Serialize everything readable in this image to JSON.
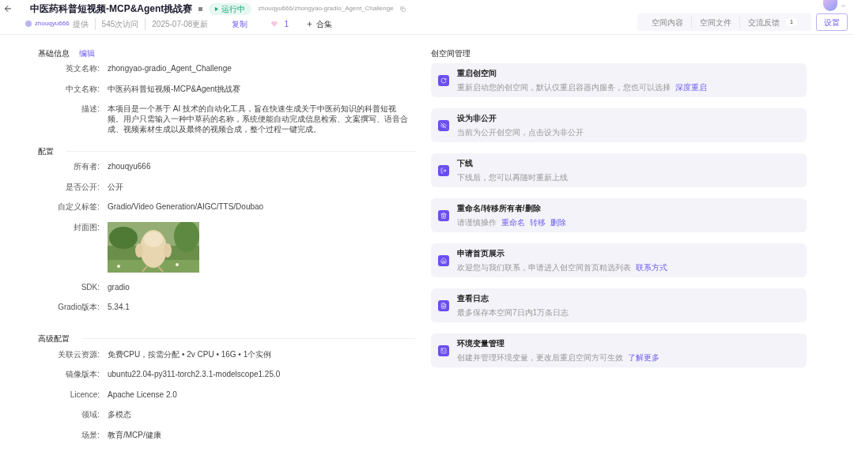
{
  "header": {
    "title": "中医药科普短视频-MCP&Agent挑战赛",
    "status": {
      "label": "运行中",
      "running": true
    },
    "path": "zhouqyu666/zhongyao-gradio_Agent_Challenge",
    "owner": "zhouqyu666",
    "provided": "提供",
    "visits": "545次访问",
    "updated": "2025-07-08更新",
    "copy": "复制",
    "likes": "1",
    "liked": false,
    "collection": "合集"
  },
  "tabs": [
    {
      "label": "空间内容",
      "selected": false
    },
    {
      "label": "空间文件",
      "selected": false
    },
    {
      "label": "交流反馈",
      "selected": false,
      "badge": "1"
    },
    {
      "label": "设置",
      "selected": true
    }
  ],
  "sections": [
    {
      "title": "基础信息",
      "action": "编辑",
      "fields": [
        {
          "kind": "text",
          "label": "英文名称:",
          "value": "zhongyao-gradio_Agent_Challenge"
        },
        {
          "kind": "text",
          "label": "中文名称:",
          "value": "中医药科普短视频-MCP&Agent挑战赛"
        },
        {
          "kind": "text",
          "label": "描述:",
          "value": "本项目是一个基于 AI 技术的自动化工具，旨在快速生成关于中医药知识的科普短视频。用户只需输入一种中草药的名称，系统便能自动完成信息检索、文案撰写、语音合成、视频素材生成以及最终的视频合成，整个过程一键完成。"
        }
      ]
    },
    {
      "title": "配置",
      "fields": [
        {
          "kind": "text",
          "label": "所有者:",
          "value": "zhouqyu666"
        },
        {
          "kind": "text",
          "label": "是否公开:",
          "value": "公开"
        },
        {
          "kind": "text",
          "label": "自定义标签:",
          "value": "Gradio/Video Generation/AIGC/TTS/Doubao"
        },
        {
          "kind": "picture",
          "label": "封面图:"
        },
        {
          "kind": "text",
          "label": "SDK:",
          "value": "gradio"
        },
        {
          "kind": "text",
          "label": "Gradio版本:",
          "value": "5.34.1"
        }
      ]
    },
    {
      "title": "高级配置",
      "fields": [
        {
          "kind": "text",
          "label": "关联云资源:",
          "value": "免费CPU，按需分配 • 2v CPU • 16G • 1个实例"
        },
        {
          "kind": "text",
          "label": "镜像版本:",
          "value": "ubuntu22.04-py311-torch2.3.1-modelscope1.25.0"
        },
        {
          "kind": "text",
          "label": "Licence:",
          "value": "Apache License 2.0"
        },
        {
          "kind": "text",
          "label": "领域:",
          "value": "多模态"
        },
        {
          "kind": "text",
          "label": "场景:",
          "value": "教育/MCP/健康"
        }
      ]
    }
  ],
  "management": {
    "title": "创空间管理",
    "cards": [
      {
        "title": "重启创空间",
        "description": "重新启动您的创空间，默认仅重启容器内服务，您也可以选择",
        "links": [
          "深度重启"
        ]
      },
      {
        "title": "设为非公开",
        "description": "当前为公开创空间，点击设为非公开"
      },
      {
        "title": "下线",
        "description": "下线后，您可以再随时重新上线"
      },
      {
        "title": "重命名/转移所有者/删除",
        "description": "请谨慎操作",
        "links": [
          "重命名",
          "转移",
          "删除"
        ]
      },
      {
        "title": "申请首页展示",
        "description": "欢迎您与我们联系，申请进入创空间首页精选列表",
        "links": [
          "联系方式"
        ]
      },
      {
        "title": "查看日志",
        "description": "最多保存本空间7日内1万条日志"
      },
      {
        "title": "环境变量管理",
        "description": "创建并管理环境变量，更改后重启空间方可生效",
        "links": [
          "了解更多"
        ]
      }
    ]
  }
}
